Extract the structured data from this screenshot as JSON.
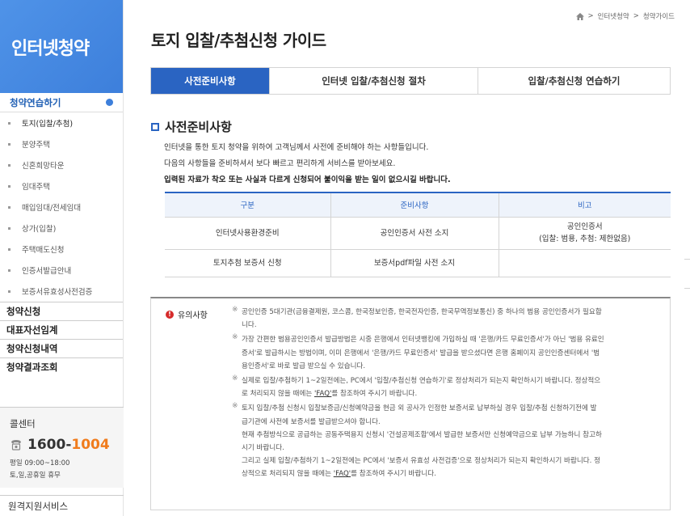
{
  "sidebar": {
    "brand": "인터넷청약",
    "top_menu": "청약연습하기",
    "sub_items": [
      "토지(입찰/추첨)",
      "분양주택",
      "신혼희망타운",
      "임대주택",
      "매입임대/전세임대",
      "상가(입찰)",
      "주택매도신청",
      "인증서발급안내",
      "보증서유효성사전검증"
    ],
    "main_items": [
      "청약신청",
      "대표자선임계",
      "청약신청내역",
      "청약결과조회"
    ],
    "callcenter": {
      "title": "콜센터",
      "phone_prefix": "1600-",
      "phone_suffix": "1004",
      "hours1": "평일 09:00~18:00",
      "hours2": "토,일,공휴일 휴무"
    },
    "remote": "원격지원서비스"
  },
  "breadcrumb": [
    "인터넷청약",
    "청약가이드"
  ],
  "page_title": "토지 입찰/추첨신청 가이드",
  "tabs": [
    "사전준비사항",
    "인터넷 입찰/추첨신청 절차",
    "입찰/추첨신청 연습하기"
  ],
  "section": {
    "title": "사전준비사항",
    "intro1": "인터넷을 통한 토지 청약을 위하여 고객님께서 사전에 준비해야 하는 사항들입니다.",
    "intro2": "다음의 사항들을 준비하셔서 보다 빠르고 편리하게 서비스를 받아보세요.",
    "intro3": "입력된 자료가 착오 또는 사실과 다르게 신청되어 불이익을 받는 일이 없으시길 바랍니다."
  },
  "table": {
    "headers": [
      "구분",
      "준비사항",
      "비고"
    ],
    "rows": [
      [
        "인터넷사용환경준비",
        "공인인증서 사전 소지",
        "공인인증서",
        "(입찰: 범용, 추첨: 제한없음)"
      ],
      [
        "토지추첨 보증서 신청",
        "보증서pdf파일 사전 소지",
        ""
      ]
    ]
  },
  "notice": {
    "label": "유의사항",
    "mark": "※",
    "items": [
      [
        "공인인증 5대기관(금융결제원, 코스콤, 한국정보인증, 한국전자인증, 한국무역정보통신) 중 하나의 범용 공인인증서가 필요합",
        "니다."
      ],
      [
        "가장 간편한 범용공인인증서 발급방법은 시중 은행에서 인터넷뱅킹에 가입하실 때 '은행/카드 무료인증서'가 아닌 '범용 유료인",
        "증서'로 발급하시는 방법이며, 이미 은행에서 '은행/카드 무료인증서' 발급을 받으셨다면 은행 홈페이지 공인인증센터에서 '범",
        "용인증서'로 바로 발급 받으실 수 있습니다."
      ],
      [
        "실제로 입찰/추첨하기 1~2일전에는, PC에서 '입찰/추첨신청 연습하기'로 정상처리가 되는지 확인하시기 바랍니다. 정상적으",
        "로 처리되지 않을 때에는 'FAQ'를 참조하여 주시기 바랍니다."
      ],
      [
        "토지 입찰/추첨 신청시 입찰보증금/신청예약금을 현금 외 공사가 인정한 보증서로 납부하실 경우 입찰/추첨 신청하기전에 발",
        "급기관에 사전에 보증서를 발급받으셔야 합니다.",
        "현재 추첨방식으로 공급하는 공동주택용지 신청시 '건설공제조합'에서 발급한 보증서만 신청예약금으로 납부 가능하니 참고하",
        "시기 바랍니다.",
        "그리고 실제 입찰/추첨하기 1~2일전에는 PC에서 '보증서 유효성 사전검증'으로 정상처리가 되는지 확인하시기 바랍니다.  정",
        "상적으로 처리되지 않을 때에는 'FAQ'를 참조하여 주시기 바랍니다."
      ]
    ]
  },
  "colors": {
    "accent": "#2a64c2",
    "brand": "#3d7fdb",
    "phone_highlight": "#f07c1d",
    "warning": "#d62b2b"
  }
}
